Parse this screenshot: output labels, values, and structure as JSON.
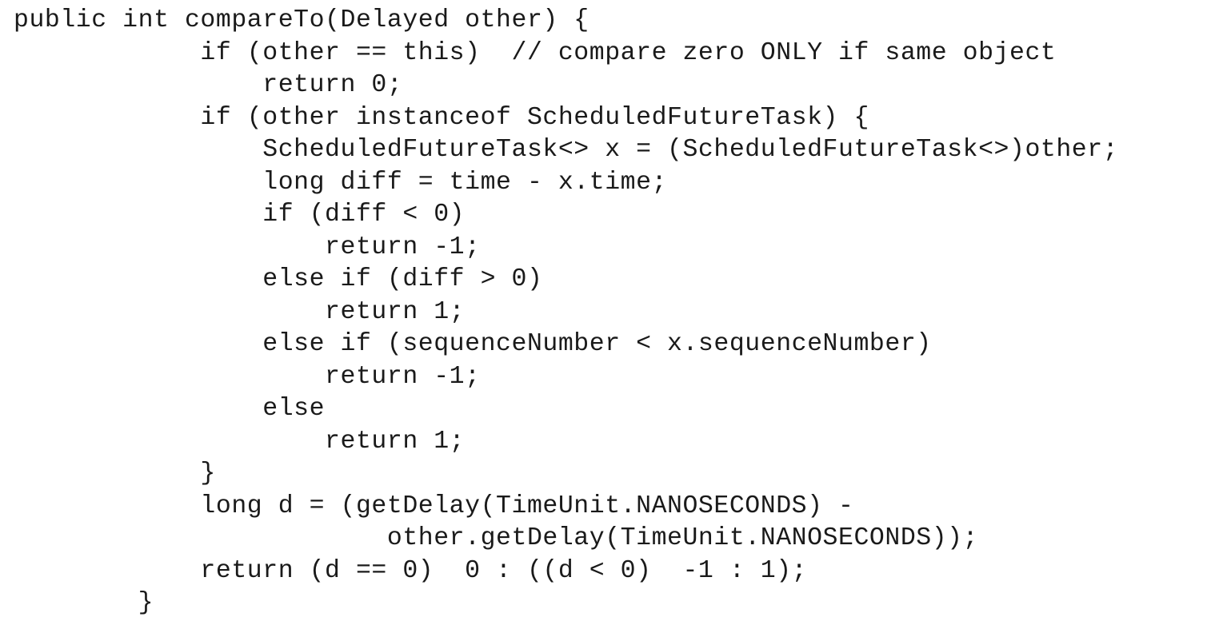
{
  "document": {
    "kind": "source-code-listing",
    "language": "Java",
    "method_name": "compareTo",
    "background_color": "#ffffff",
    "text_color": "#1a1a1a",
    "line_count": 19
  },
  "code": {
    "lines": [
      "public int compareTo(Delayed other) {",
      "            if (other == this)  // compare zero ONLY if same object",
      "                return 0;",
      "            if (other instanceof ScheduledFutureTask) {",
      "                ScheduledFutureTask<> x = (ScheduledFutureTask<>)other;",
      "                long diff = time - x.time;",
      "                if (diff < 0)",
      "                    return -1;",
      "                else if (diff > 0)",
      "                    return 1;",
      "                else if (sequenceNumber < x.sequenceNumber)",
      "                    return -1;",
      "                else",
      "                    return 1;",
      "            }",
      "            long d = (getDelay(TimeUnit.NANOSECONDS) -",
      "                        other.getDelay(TimeUnit.NANOSECONDS));",
      "            return (d == 0)  0 : ((d < 0)  -1 : 1);",
      "        }"
    ]
  }
}
